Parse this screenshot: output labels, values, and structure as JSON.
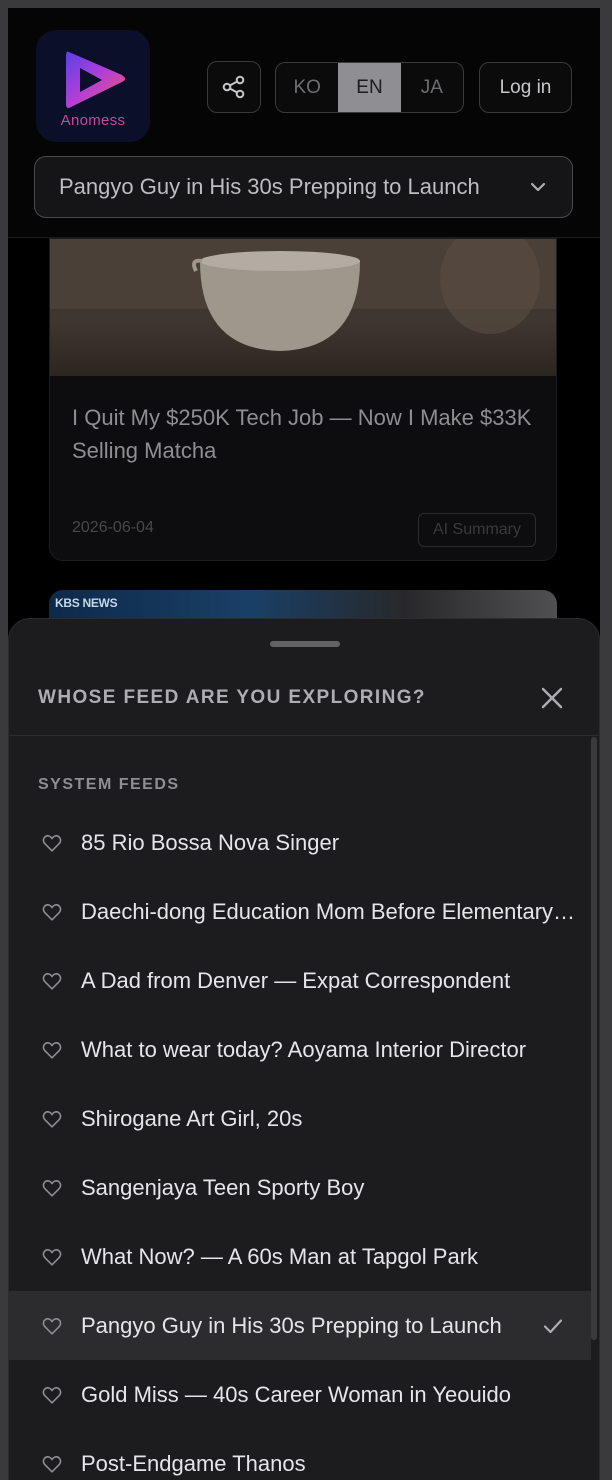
{
  "header": {
    "logo_text": "Anomess",
    "languages": [
      {
        "code": "KO",
        "active": false
      },
      {
        "code": "EN",
        "active": true
      },
      {
        "code": "JA",
        "active": false
      }
    ],
    "login_label": "Log in",
    "feed_select_value": "Pangyo Guy in His 30s Prepping to Launch"
  },
  "card": {
    "title": "I Quit My $250K Tech Job — Now I Make $33K Selling Matcha",
    "date": "2026-06-04",
    "badge": "AI Summary"
  },
  "card2": {
    "tag": "KBS NEWS"
  },
  "sheet": {
    "title": "WHOSE FEED ARE YOU EXPLORING?",
    "section_label": "SYSTEM FEEDS",
    "items": [
      {
        "name": "85 Rio Bossa Nova Singer",
        "selected": false
      },
      {
        "name": "Daechi-dong Education Mom Before Elementary School",
        "selected": false
      },
      {
        "name": "A Dad from Denver — Expat Correspondent",
        "selected": false
      },
      {
        "name": "What to wear today? Aoyama Interior Director",
        "selected": false
      },
      {
        "name": "Shirogane Art Girl, 20s",
        "selected": false
      },
      {
        "name": "Sangenjaya Teen Sporty Boy",
        "selected": false
      },
      {
        "name": "What Now? — A 60s Man at Tapgol Park",
        "selected": false
      },
      {
        "name": "Pangyo Guy in His 30s Prepping to Launch",
        "selected": true
      },
      {
        "name": "Gold Miss — 40s Career Woman in Yeouido",
        "selected": false
      },
      {
        "name": "Post-Endgame Thanos",
        "selected": false
      }
    ]
  },
  "colors": {
    "background": "#000000",
    "sheet": "#1c1c1e",
    "selected_row": "#2c2c2e",
    "lang_active": "#8e8e93",
    "logo_gradient": [
      "#7b3fe4",
      "#e0408f"
    ]
  },
  "icons": {
    "share": "share-icon",
    "chevron": "chevron-down-icon",
    "close": "close-icon",
    "heart": "heart-icon",
    "check": "check-icon"
  }
}
